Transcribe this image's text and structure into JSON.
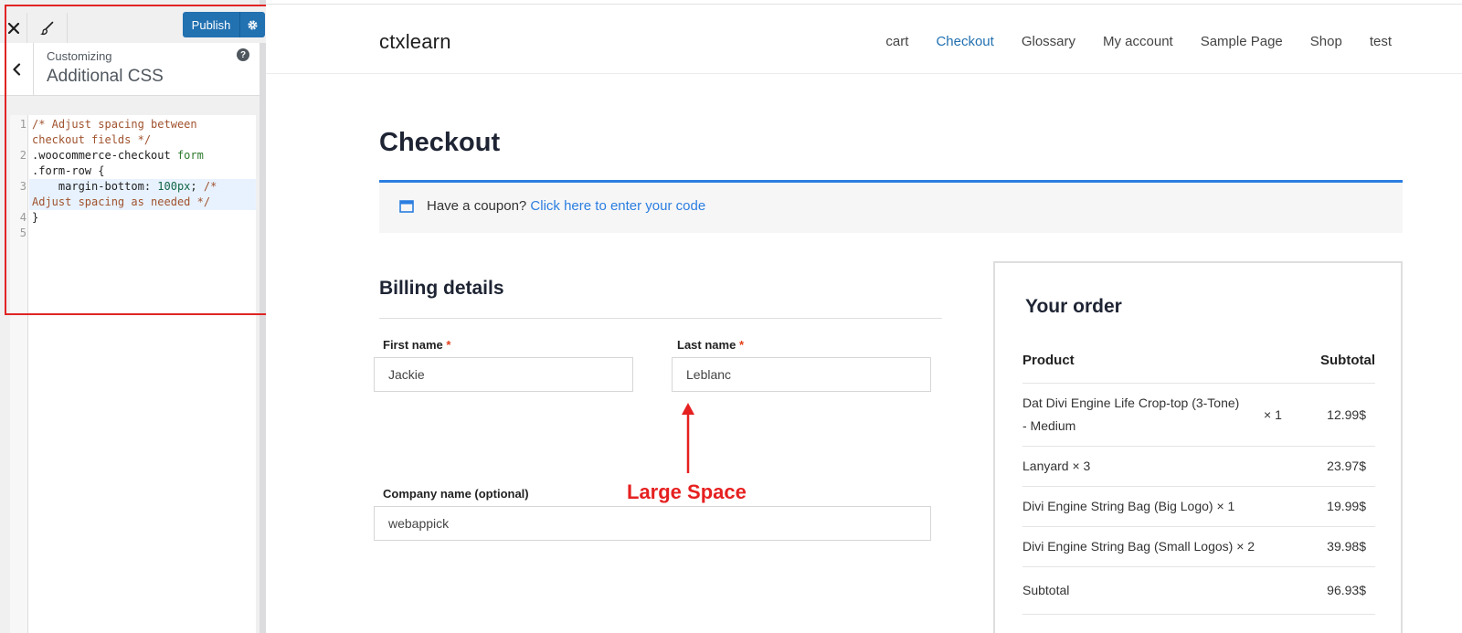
{
  "customizer": {
    "publish_label": "Publish",
    "customizing_label": "Customizing",
    "section_title": "Additional CSS",
    "help_glyph": "?",
    "code_lines": [
      {
        "num": "1",
        "parts": [
          {
            "t": "/* Adjust spacing between",
            "c": "cm"
          }
        ]
      },
      {
        "num": "",
        "parts": [
          {
            "t": "checkout fields */",
            "c": "cm"
          }
        ]
      },
      {
        "num": "2",
        "parts": [
          {
            "t": ".woocommerce-checkout ",
            "c": ""
          },
          {
            "t": "form",
            "c": "kw"
          }
        ]
      },
      {
        "num": "",
        "parts": [
          {
            "t": ".form-row {",
            "c": ""
          }
        ]
      },
      {
        "num": "3",
        "parts": [
          {
            "t": "    margin-bottom: ",
            "c": ""
          },
          {
            "t": "100px",
            "c": "num"
          },
          {
            "t": "; ",
            "c": ""
          },
          {
            "t": "/*",
            "c": "cm"
          }
        ]
      },
      {
        "num": "",
        "parts": [
          {
            "t": "Adjust spacing as needed */",
            "c": "cm"
          }
        ]
      },
      {
        "num": "4",
        "parts": [
          {
            "t": "}",
            "c": ""
          }
        ]
      },
      {
        "num": "5",
        "parts": []
      }
    ]
  },
  "site": {
    "title": "ctxlearn",
    "nav": [
      {
        "label": "cart",
        "active": false
      },
      {
        "label": "Checkout",
        "active": true
      },
      {
        "label": "Glossary",
        "active": false
      },
      {
        "label": "My account",
        "active": false
      },
      {
        "label": "Sample Page",
        "active": false
      },
      {
        "label": "Shop",
        "active": false
      },
      {
        "label": "test",
        "active": false
      }
    ],
    "page_title": "Checkout",
    "coupon": {
      "text": "Have a coupon?",
      "link": "Click here to enter your code"
    },
    "billing": {
      "title": "Billing details",
      "first_name_label": "First name",
      "first_name_value": "Jackie",
      "last_name_label": "Last name",
      "last_name_value": "Leblanc",
      "required_mark": "*",
      "company_label": "Company name (optional)",
      "company_value": "webappick"
    },
    "annotation": "Large Space",
    "order": {
      "title": "Your order",
      "col_product": "Product",
      "col_subtotal": "Subtotal",
      "items": [
        {
          "name_line1": "Dat Divi Engine Life Crop-top (3-Tone)",
          "name_line2": "- Medium",
          "qty": "× 1",
          "price": "12.99$"
        },
        {
          "name_line1": "Lanyard × 3",
          "name_line2": "",
          "qty": "",
          "price": "23.97$"
        },
        {
          "name_line1": "Divi Engine String Bag (Big Logo) × 1",
          "name_line2": "",
          "qty": "",
          "price": "19.99$"
        },
        {
          "name_line1": "Divi Engine String Bag (Small Logos) × 2",
          "name_line2": "",
          "qty": "",
          "price": "39.98$"
        }
      ],
      "subtotal_label": "Subtotal",
      "subtotal_value": "96.93$"
    }
  },
  "colors": {
    "accent": "#2271b1",
    "link": "#2b7ee0",
    "annotation": "#e62020"
  },
  "icons": [
    "close-icon",
    "paintbrush-icon",
    "gear-icon",
    "chevron-left-icon",
    "help-icon",
    "coupon-icon"
  ]
}
